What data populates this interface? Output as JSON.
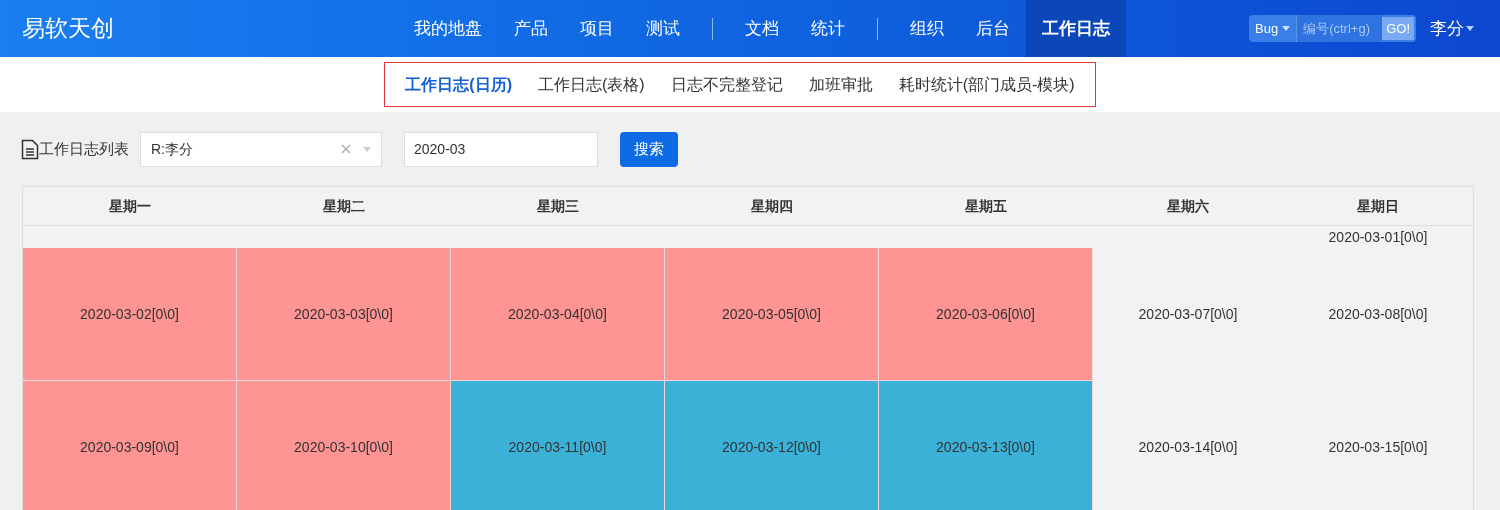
{
  "brand": "易软天创",
  "nav": {
    "groups": [
      [
        {
          "label": "我的地盘",
          "selected": false
        },
        {
          "label": "产品",
          "selected": false
        },
        {
          "label": "项目",
          "selected": false
        },
        {
          "label": "测试",
          "selected": false
        }
      ],
      [
        {
          "label": "文档",
          "selected": false
        },
        {
          "label": "统计",
          "selected": false
        }
      ],
      [
        {
          "label": "组织",
          "selected": false
        },
        {
          "label": "后台",
          "selected": false
        },
        {
          "label": "工作日志",
          "selected": true
        }
      ]
    ]
  },
  "quick_search": {
    "type": "Bug",
    "placeholder": "编号(ctrl+g)",
    "button": "GO!"
  },
  "user": "李分",
  "subnav": [
    {
      "label": "工作日志(日历)",
      "selected": true
    },
    {
      "label": "工作日志(表格)",
      "selected": false
    },
    {
      "label": "日志不完整登记",
      "selected": false
    },
    {
      "label": "加班审批",
      "selected": false
    },
    {
      "label": "耗时统计(部门成员-模块)",
      "selected": false
    }
  ],
  "filter": {
    "title": "工作日志列表",
    "person": "R:李分",
    "month": "2020-03",
    "search_button": "搜索"
  },
  "calendar": {
    "weekdays": [
      "星期一",
      "星期二",
      "星期三",
      "星期四",
      "星期五",
      "星期六",
      "星期日"
    ],
    "weeks": [
      {
        "days": [
          {
            "label": "2020-03-01[0\\0]"
          }
        ]
      },
      {
        "days": [
          {
            "label": "2020-03-02[0\\0]",
            "color": "#ff9494"
          },
          {
            "label": "2020-03-03[0\\0]",
            "color": "#ff9494"
          },
          {
            "label": "2020-03-04[0\\0]",
            "color": "#ff9494"
          },
          {
            "label": "2020-03-05[0\\0]",
            "color": "#ff9494"
          },
          {
            "label": "2020-03-06[0\\0]",
            "color": "#ff9494"
          },
          {
            "label": "2020-03-07[0\\0]"
          },
          {
            "label": "2020-03-08[0\\0]"
          }
        ]
      },
      {
        "days": [
          {
            "label": "2020-03-09[0\\0]",
            "color": "#ff9494"
          },
          {
            "label": "2020-03-10[0\\0]",
            "color": "#ff9494"
          },
          {
            "label": "2020-03-11[0\\0]",
            "color": "#3bb1d8"
          },
          {
            "label": "2020-03-12[0\\0]",
            "color": "#3bb1d8"
          },
          {
            "label": "2020-03-13[0\\0]",
            "color": "#3bb1d8"
          },
          {
            "label": "2020-03-14[0\\0]"
          },
          {
            "label": "2020-03-15[0\\0]"
          }
        ]
      }
    ]
  }
}
